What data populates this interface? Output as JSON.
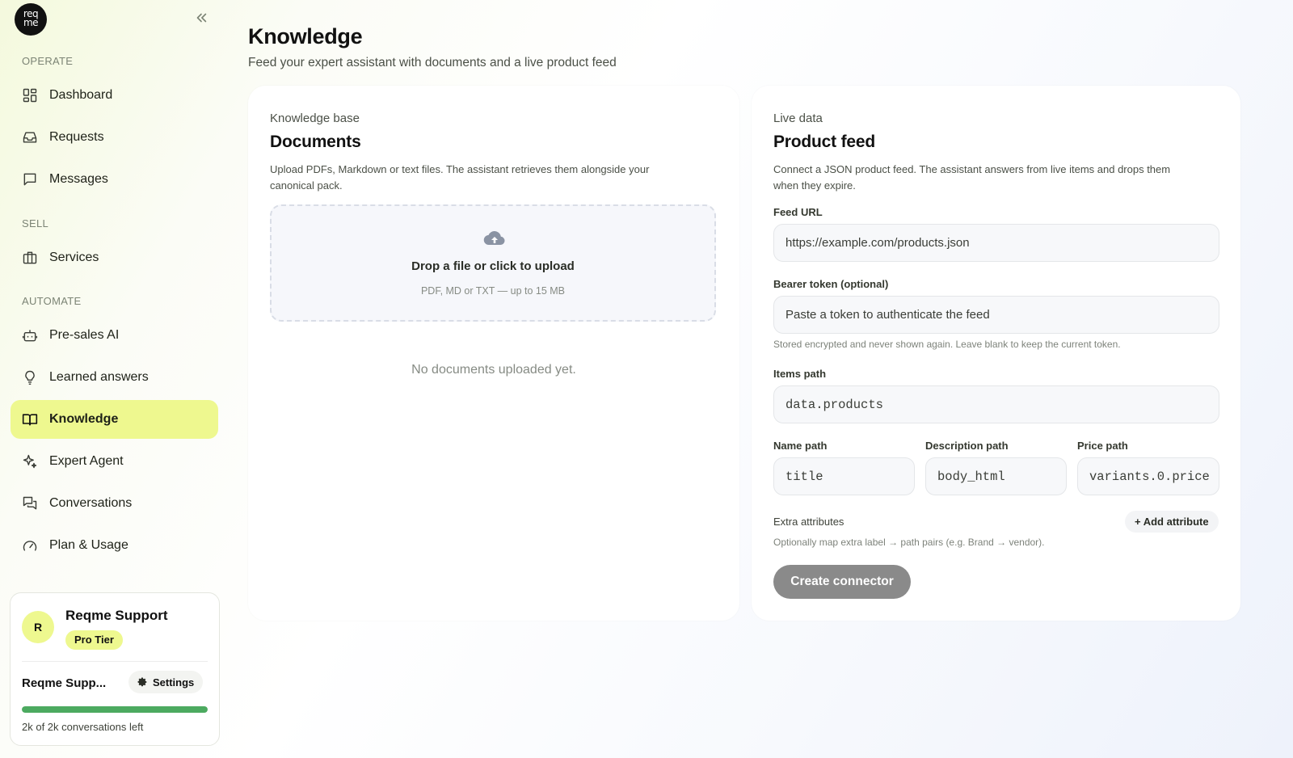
{
  "logo": {
    "line1": "req",
    "line2": "me"
  },
  "sidebar": {
    "sections": {
      "operate": "OPERATE",
      "sell": "SELL",
      "automate": "AUTOMATE"
    },
    "items": [
      {
        "label": "Dashboard",
        "icon": "dashboard-icon"
      },
      {
        "label": "Requests",
        "icon": "inbox-icon"
      },
      {
        "label": "Messages",
        "icon": "message-icon"
      },
      {
        "label": "Services",
        "icon": "briefcase-icon"
      },
      {
        "label": "Pre-sales AI",
        "icon": "bot-icon"
      },
      {
        "label": "Learned answers",
        "icon": "lightbulb-icon"
      },
      {
        "label": "Knowledge",
        "icon": "book-icon",
        "active": true
      },
      {
        "label": "Expert Agent",
        "icon": "sparkles-icon"
      },
      {
        "label": "Conversations",
        "icon": "chats-icon"
      },
      {
        "label": "Plan & Usage",
        "icon": "gauge-icon"
      }
    ]
  },
  "account": {
    "avatar_initial": "R",
    "name": "Reqme Support",
    "tier": "Pro Tier",
    "short_name": "Reqme Supp...",
    "settings_label": "Settings",
    "usage_text": "2k of 2k conversations left",
    "usage_fraction": 1.0
  },
  "page": {
    "title": "Knowledge",
    "subtitle": "Feed your expert assistant with documents and a live product feed"
  },
  "documents": {
    "eyebrow": "Knowledge base",
    "title": "Documents",
    "description_line1": "Upload PDFs, Markdown or text files. The assistant retrieves them alongside your",
    "description_line2": "canonical pack.",
    "dropzone_title": "Drop a file or click to upload",
    "dropzone_hint": "PDF, MD or TXT — up to 15 MB",
    "empty_state": "No documents uploaded yet."
  },
  "feed": {
    "eyebrow": "Live data",
    "title": "Product feed",
    "description_line1": "Connect a JSON product feed. The assistant answers from live items and drops them",
    "description_line2": "when they expire.",
    "url_label": "Feed URL",
    "url_placeholder": "https://example.com/products.json",
    "token_label": "Bearer token (optional)",
    "token_placeholder": "Paste a token to authenticate the feed",
    "token_helper": "Stored encrypted and never shown again. Leave blank to keep the current token.",
    "items_path_label": "Items path",
    "items_path_value": "data.products",
    "name_path_label": "Name path",
    "name_path_value": "title",
    "description_path_label": "Description path",
    "description_path_value": "body_html",
    "price_path_label": "Price path",
    "price_path_value": "variants.0.price",
    "extra_label": "Extra attributes",
    "add_attribute_label": "+ Add attribute",
    "extra_helper": "Optionally map extra label → path pairs (e.g. Brand → vendor).",
    "create_label": "Create connector"
  },
  "colors": {
    "accent": "#eef88f",
    "progress": "#4caa60",
    "button_disabled": "#8a8a8a"
  }
}
